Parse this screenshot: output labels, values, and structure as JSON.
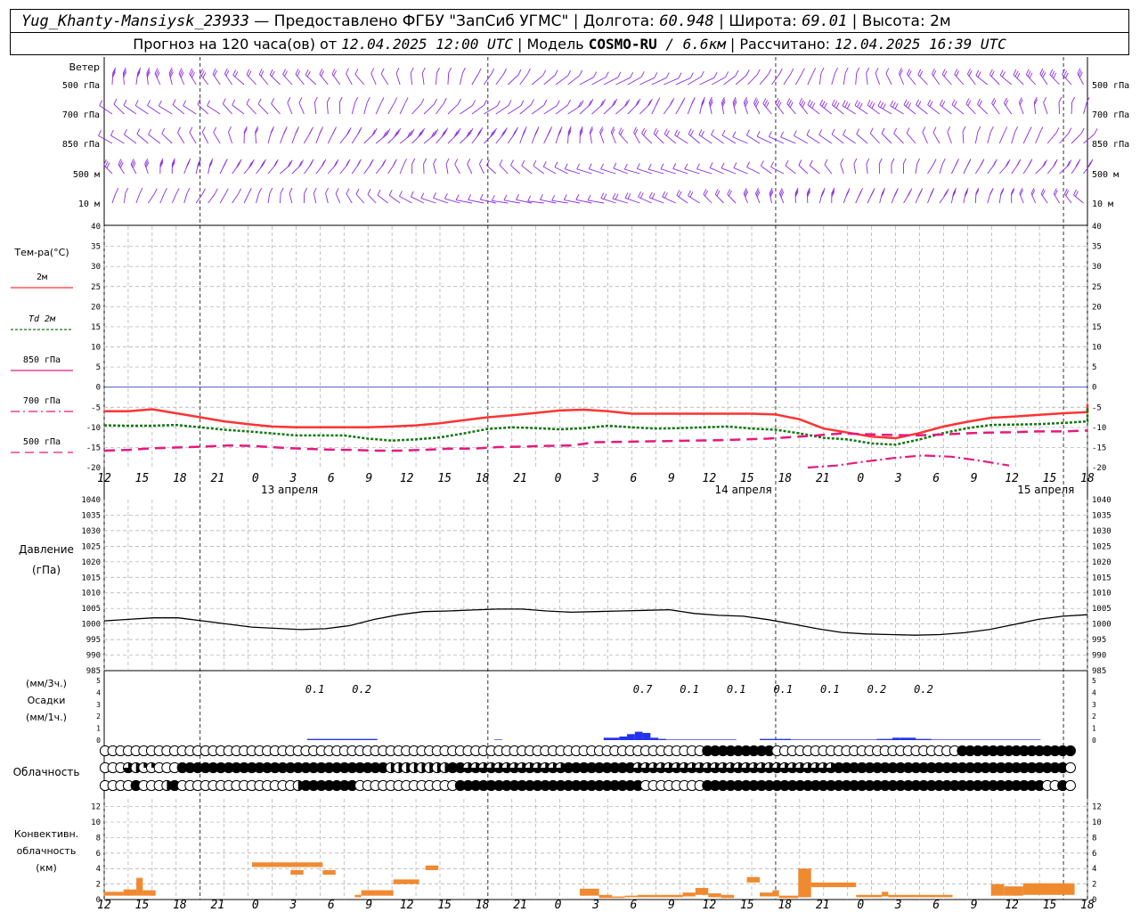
{
  "header": {
    "station": "Yug_Khanty-Mansiysk_23933",
    "provider": " — Предоставлено ФГБУ \"ЗапСиб УГМС\" | Долгота: ",
    "lon": "60.948",
    "lat_label": " | Широта: ",
    "lat": "69.01",
    "alt_label": " | Высота: ",
    "alt": "2м",
    "forecast_label": "Прогноз на 120 часа(ов) от ",
    "start": "12.04.2025 12:00 UTC",
    "model_label": " | Модель ",
    "model": "COSMO-RU",
    "res": " / 6.6км",
    "calc_label": " | Рассчитано: ",
    "calc": "12.04.2025 16:39 UTC"
  },
  "wind_panel": {
    "title": "Ветер",
    "levels": [
      "500 гПа",
      "700 гПа",
      "850 гПа",
      "500 м",
      "10 м"
    ]
  },
  "temp_panel": {
    "title": "Тем-ра(°С)",
    "legend": [
      {
        "label": "2м",
        "color": "#ff3333",
        "dash": "solid"
      },
      {
        "label": "Td 2м",
        "color": "#117711",
        "dash": "dotted"
      },
      {
        "label": "850 гПа",
        "color": "#e6197f",
        "dash": "solid"
      },
      {
        "label": "700 гПа",
        "color": "#e6197f",
        "dash": "dashdot"
      },
      {
        "label": "500 гПа",
        "color": "#e6197f",
        "dash": "dashed"
      }
    ]
  },
  "pressure_panel": {
    "title": "Давление",
    "unit": "(гПа)"
  },
  "precip_panel": {
    "unit_3h": "(мм/3ч.)",
    "title": "Осадки",
    "unit_1h": "(мм/1ч.)"
  },
  "cloud_panel": {
    "title": "Облачность"
  },
  "conv_panel": {
    "title1": "Конвективн.",
    "title2": "облачность",
    "unit": "(км)"
  },
  "time_axis": {
    "hour_labels": [
      "12",
      "15",
      "18",
      "21",
      "0",
      "3",
      "6",
      "9",
      "12",
      "15",
      "18",
      "21",
      "0",
      "3",
      "6",
      "9",
      "12",
      "15",
      "18",
      "21",
      "0",
      "3",
      "6",
      "9",
      "12",
      "15",
      "18"
    ],
    "dates": [
      "13 апреля",
      "14 апреля",
      "15 апреля"
    ]
  },
  "colors": {
    "wind": "#8a2be2",
    "t2m": "#ff3333",
    "td": "#117711",
    "upper": "#e6197f",
    "precip": "#2233ee",
    "conv": "#f08a30",
    "zero": "#3344cc"
  },
  "chart_data": [
    {
      "type": "line",
      "title": "Тем-ра(°С)",
      "x_unit": "hours from 12.04.2025 12:00 UTC",
      "ylim": [
        -20,
        40
      ],
      "yticks": [
        -20,
        -15,
        -10,
        -5,
        0,
        5,
        10,
        15,
        20,
        25,
        30,
        35,
        40
      ],
      "grid": true,
      "series": [
        {
          "name": "2м",
          "x": [
            0,
            3,
            6,
            9,
            12,
            15,
            18,
            21,
            24,
            27,
            30,
            33,
            36,
            39,
            42,
            45,
            48,
            51,
            54,
            57,
            60,
            63,
            66,
            69,
            72,
            75,
            78,
            81,
            84,
            87,
            90,
            93,
            96,
            99,
            102,
            105,
            108,
            111,
            114,
            117,
            120,
            123,
            126,
            129,
            132,
            135,
            138,
            141,
            144,
            147,
            150,
            153
          ],
          "y": [
            -6,
            -6,
            -5.5,
            -6.5,
            -7.5,
            -8.5,
            -9.2,
            -9.8,
            -10,
            -10,
            -10,
            -10,
            -9.8,
            -9.5,
            -9,
            -8.2,
            -7.5,
            -7,
            -6.4,
            -5.8,
            -5.6,
            -6,
            -6.6,
            -6.6,
            -6.6,
            -6.6,
            -6.6,
            -6.6,
            -6.8,
            -8,
            -10.3,
            -11.3,
            -12.3,
            -12.7,
            -11.4,
            -9.8,
            -8.6,
            -7.6,
            -7.3,
            -6.9,
            -6.5,
            -6.2,
            -5.8,
            -5.4,
            -5.1,
            -4.8,
            -4.9,
            -4.8,
            -4.6,
            -4.3,
            -4.2,
            -4.3
          ]
        },
        {
          "name": "Td 2м",
          "x": [
            0,
            3,
            6,
            9,
            12,
            15,
            18,
            21,
            24,
            27,
            30,
            33,
            36,
            39,
            42,
            45,
            48,
            51,
            54,
            57,
            60,
            63,
            66,
            69,
            72,
            75,
            78,
            81,
            84,
            87,
            90,
            93,
            96,
            99,
            102,
            105,
            108,
            111,
            114,
            117,
            120,
            123,
            126,
            129,
            132,
            135,
            138,
            141,
            144,
            147,
            150,
            153
          ],
          "y": [
            -9.5,
            -9.6,
            -9.6,
            -9.4,
            -10,
            -10.6,
            -11,
            -11.5,
            -12,
            -12,
            -12,
            -12.8,
            -13.3,
            -13,
            -12.5,
            -11.5,
            -10.4,
            -10,
            -10.2,
            -10.5,
            -10.2,
            -9.6,
            -10,
            -10.3,
            -10.2,
            -10,
            -9.8,
            -10.3,
            -10.6,
            -11.5,
            -12.6,
            -13,
            -14,
            -14.3,
            -13,
            -11.4,
            -10.2,
            -9.4,
            -9.3,
            -9.2,
            -8.9,
            -8.5,
            -8,
            -7.4,
            -6.8,
            -6.7,
            -6,
            -5.6,
            -5.2,
            -5.5,
            -5.6,
            -5.8
          ]
        },
        {
          "name": "500 гПа",
          "x": [
            0,
            6,
            12,
            18,
            24,
            30,
            36,
            42,
            48,
            54,
            60,
            66,
            72,
            78,
            84,
            90,
            96,
            102,
            108,
            114,
            120,
            126,
            132,
            138,
            144,
            150,
            156,
            162,
            168,
            174,
            180,
            186,
            192,
            198,
            204,
            210,
            216,
            222,
            228,
            234,
            240
          ],
          "y": [
            -15.8,
            -15.6,
            -15.2,
            -15,
            -14.8,
            -14.5,
            -14.6,
            -15,
            -15.3,
            -15.5,
            -15.6,
            -15.8,
            -15.8,
            -15.6,
            -15.3,
            -15.3,
            -14.9,
            -14.8,
            -14.6,
            -14.5,
            -13.7,
            -13.6,
            -13.5,
            -13.4,
            -13.3,
            -13.2,
            -13,
            -12.8,
            -12.4,
            -12,
            -11.5,
            -11.7,
            -11.9,
            -12,
            -11.8,
            -11.5,
            -11.3,
            -11.2,
            -11,
            -11,
            -10.8
          ]
        }
      ]
    },
    {
      "type": "line",
      "title": "Давление",
      "ylabel": "(гПа)",
      "ylim": [
        985,
        1040
      ],
      "yticks": [
        985,
        990,
        995,
        1000,
        1005,
        1010,
        1015,
        1020,
        1025,
        1030,
        1035,
        1040
      ],
      "grid": true,
      "series": [
        {
          "name": "Давление",
          "x": [
            0,
            6,
            12,
            18,
            24,
            30,
            36,
            42,
            48,
            54,
            60,
            66,
            72,
            78,
            84,
            90,
            96,
            102,
            108,
            114,
            120,
            126,
            132,
            138,
            144,
            150,
            156,
            162,
            168,
            174,
            180,
            186,
            192,
            198,
            204,
            210,
            216,
            222,
            228,
            234,
            240
          ],
          "y": [
            1001,
            1001.5,
            1002,
            1002,
            1001,
            1000,
            999,
            998.6,
            998.2,
            998.5,
            999.5,
            1001.5,
            1003,
            1004,
            1004.2,
            1004.5,
            1004.8,
            1004.8,
            1004.2,
            1003.8,
            1004,
            1004.2,
            1004.4,
            1004.6,
            1003.4,
            1002.8,
            1002.5,
            1001.4,
            1000,
            998.5,
            997.3,
            996.8,
            996.6,
            996.4,
            996.6,
            997.2,
            998.2,
            999.8,
            1001.5,
            1002.5,
            1003
          ]
        }
      ]
    },
    {
      "type": "bar",
      "title": "Осадки",
      "ylabel": "(мм/1ч.)",
      "ylim": [
        0,
        5
      ],
      "annotations": [
        {
          "x": 27,
          "label": "0.1"
        },
        {
          "x": 33,
          "label": "0.2"
        },
        {
          "x": 69,
          "label": "0.7"
        },
        {
          "x": 75,
          "label": "0.1"
        },
        {
          "x": 81,
          "label": "0.1"
        },
        {
          "x": 87,
          "label": "0.1"
        },
        {
          "x": 93,
          "label": "0.1"
        },
        {
          "x": 99,
          "label": "0.2"
        },
        {
          "x": 105,
          "label": "0.2"
        }
      ],
      "x": [
        26,
        27,
        28,
        29,
        30,
        31,
        32,
        33,
        34,
        50,
        64,
        65,
        66,
        67,
        68,
        69,
        70,
        71,
        72,
        73,
        74,
        75,
        76,
        77,
        78,
        79,
        80,
        84,
        85,
        86,
        87,
        88,
        89,
        90,
        91,
        92,
        93,
        94,
        95,
        96,
        97,
        98,
        99,
        100,
        101,
        102,
        103,
        104,
        105,
        106,
        107,
        108,
        109,
        110,
        111,
        112,
        113,
        114,
        115,
        116,
        117,
        118,
        119
      ],
      "values": [
        0.1,
        0.1,
        0.1,
        0.1,
        0.1,
        0.1,
        0.1,
        0.1,
        0.1,
        0.05,
        0.2,
        0.2,
        0.3,
        0.5,
        0.7,
        0.6,
        0.2,
        0.1,
        0.05,
        0.05,
        0.05,
        0.05,
        0.05,
        0.05,
        0.05,
        0.05,
        0.05,
        0.1,
        0.1,
        0.1,
        0.1,
        0.05,
        0.05,
        0.05,
        0.05,
        0.05,
        0.05,
        0.05,
        0.05,
        0.05,
        0.05,
        0.05,
        0.1,
        0.1,
        0.2,
        0.2,
        0.2,
        0.1,
        0.1,
        0.05,
        0.05,
        0.05,
        0.05,
        0.05,
        0.05,
        0.05,
        0.05,
        0.05,
        0.05,
        0.05,
        0.05,
        0.05,
        0.05
      ]
    },
    {
      "type": "table",
      "title": "Облачность",
      "rows": 3,
      "note": "cloud cover in oktas per hour (0-8), rows: low-top, mid, bottom",
      "cover": [
        "000000000000000000000000000000000000000000000000000000000000000000000000000000888888888000000000000000000000000888888888888888",
        "000642200088888888888888888888888888844444444886666666666666888888888666666666666666666666666668888888888888888888888888888880",
        "000080004800000000000000048888888000000000000088888888888888888888888800000000888888888888888888888888888888888888888888880080"
      ]
    },
    {
      "type": "bar",
      "title": "Конвективн. облачность",
      "ylabel": "(км)",
      "ylim": [
        0,
        13
      ],
      "yticks": [
        0,
        2,
        4,
        6,
        8,
        10,
        12
      ],
      "segments": [
        {
          "x0": 0,
          "x1": 3,
          "base": 0.5,
          "top": 1
        },
        {
          "x0": 3,
          "x1": 5,
          "base": 0.5,
          "top": 1.3
        },
        {
          "x0": 5,
          "x1": 6,
          "base": 0.5,
          "top": 2.8
        },
        {
          "x0": 6,
          "x1": 8,
          "base": 0.5,
          "top": 1.2
        },
        {
          "x0": 23,
          "x1": 32,
          "base": 4.2,
          "top": 4.8
        },
        {
          "x0": 29,
          "x1": 31,
          "base": 3.2,
          "top": 3.8
        },
        {
          "x0": 32,
          "x1": 34,
          "base": 4.2,
          "top": 4.8
        },
        {
          "x0": 34,
          "x1": 36,
          "base": 3.2,
          "top": 3.8
        },
        {
          "x0": 39,
          "x1": 40,
          "base": 0.3,
          "top": 0.6
        },
        {
          "x0": 40,
          "x1": 45,
          "base": 0.5,
          "top": 1.2
        },
        {
          "x0": 45,
          "x1": 49,
          "base": 2.0,
          "top": 2.6
        },
        {
          "x0": 50,
          "x1": 52,
          "base": 3.8,
          "top": 4.4
        },
        {
          "x0": 74,
          "x1": 77,
          "base": 0.5,
          "top": 1.4
        },
        {
          "x0": 77,
          "x1": 79,
          "base": 0.2,
          "top": 0.6
        },
        {
          "x0": 79,
          "x1": 81,
          "base": 0.2,
          "top": 0.4
        },
        {
          "x0": 81,
          "x1": 83,
          "base": 0.3,
          "top": 0.5
        },
        {
          "x0": 83,
          "x1": 90,
          "base": 0.3,
          "top": 0.6
        },
        {
          "x0": 90,
          "x1": 92,
          "base": 0.4,
          "top": 0.9
        },
        {
          "x0": 92,
          "x1": 94,
          "base": 0.6,
          "top": 1.5
        },
        {
          "x0": 94,
          "x1": 96,
          "base": 0.3,
          "top": 0.8
        },
        {
          "x0": 96,
          "x1": 98,
          "base": 0.2,
          "top": 0.6
        },
        {
          "x0": 100,
          "x1": 102,
          "base": 2.2,
          "top": 2.9
        },
        {
          "x0": 102,
          "x1": 104,
          "base": 0.4,
          "top": 0.9
        },
        {
          "x0": 104,
          "x1": 105,
          "base": 0.4,
          "top": 1.2
        },
        {
          "x0": 105,
          "x1": 108,
          "base": 0.2,
          "top": 0.5
        },
        {
          "x0": 108,
          "x1": 110,
          "base": 0.3,
          "top": 4.0
        },
        {
          "x0": 110,
          "x1": 117,
          "base": 1.6,
          "top": 2.2
        },
        {
          "x0": 117,
          "x1": 121,
          "base": 0.3,
          "top": 0.6
        },
        {
          "x0": 121,
          "x1": 122,
          "base": 0.4,
          "top": 1.0
        },
        {
          "x0": 122,
          "x1": 132,
          "base": 0.3,
          "top": 0.6
        },
        {
          "x0": 138,
          "x1": 140,
          "base": 0.5,
          "top": 2.0
        },
        {
          "x0": 140,
          "x1": 143,
          "base": 0.5,
          "top": 1.7
        },
        {
          "x0": 143,
          "x1": 151,
          "base": 0.6,
          "top": 2.1
        }
      ]
    }
  ]
}
